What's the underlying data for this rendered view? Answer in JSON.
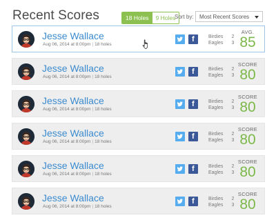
{
  "header": {
    "title": "Recent Scores",
    "filter_options": [
      {
        "label": "18 Holes",
        "active": true
      },
      {
        "label": "9 Holes",
        "active": false
      }
    ],
    "sort_label": "Sort by:",
    "sort_selected": "Most Recent Scores"
  },
  "colors": {
    "accent_green": "#8cc152",
    "link_blue": "#3b8bd0",
    "twitter": "#55acee",
    "facebook": "#3b5998"
  },
  "icons": {
    "share_1": "twitter-icon",
    "share_2": "facebook-icon",
    "sort": "chevron-down-icon"
  },
  "scores": [
    {
      "name": "Jesse Wallace",
      "date": "Aug 06, 2014 at 8:00pm",
      "holes": "18 holes",
      "birdies_label": "Birdies",
      "birdies": "2",
      "eagles_label": "Eagles",
      "eagles": "3",
      "score_label": "AVG.",
      "score": "85"
    },
    {
      "name": "Jesse Wallace",
      "date": "Aug 06, 2014 at 8:00pm",
      "holes": "18 holes",
      "birdies_label": "Birdies",
      "birdies": "2",
      "eagles_label": "Eagles",
      "eagles": "3",
      "score_label": "SCORE",
      "score": "80"
    },
    {
      "name": "Jesse Wallace",
      "date": "Aug 06, 2014 at 8:00pm",
      "holes": "18 holes",
      "birdies_label": "Birdies",
      "birdies": "2",
      "eagles_label": "Eagles",
      "eagles": "3",
      "score_label": "SCORE",
      "score": "80"
    },
    {
      "name": "Jesse Wallace",
      "date": "Aug 06, 2014 at 8:00pm",
      "holes": "18 holes",
      "birdies_label": "Birdies",
      "birdies": "2",
      "eagles_label": "Eagles",
      "eagles": "3",
      "score_label": "SCORE",
      "score": "80"
    },
    {
      "name": "Jesse Wallace",
      "date": "Aug 06, 2014 at 8:00pm",
      "holes": "18 holes",
      "birdies_label": "Birdies",
      "birdies": "2",
      "eagles_label": "Eagles",
      "eagles": "3",
      "score_label": "SCORE",
      "score": "80"
    },
    {
      "name": "Jesse Wallace",
      "date": "Aug 06, 2014 at 8:00pm",
      "holes": "18 holes",
      "birdies_label": "Birdies",
      "birdies": "2",
      "eagles_label": "Eagles",
      "eagles": "3",
      "score_label": "SCORE",
      "score": "80"
    }
  ]
}
